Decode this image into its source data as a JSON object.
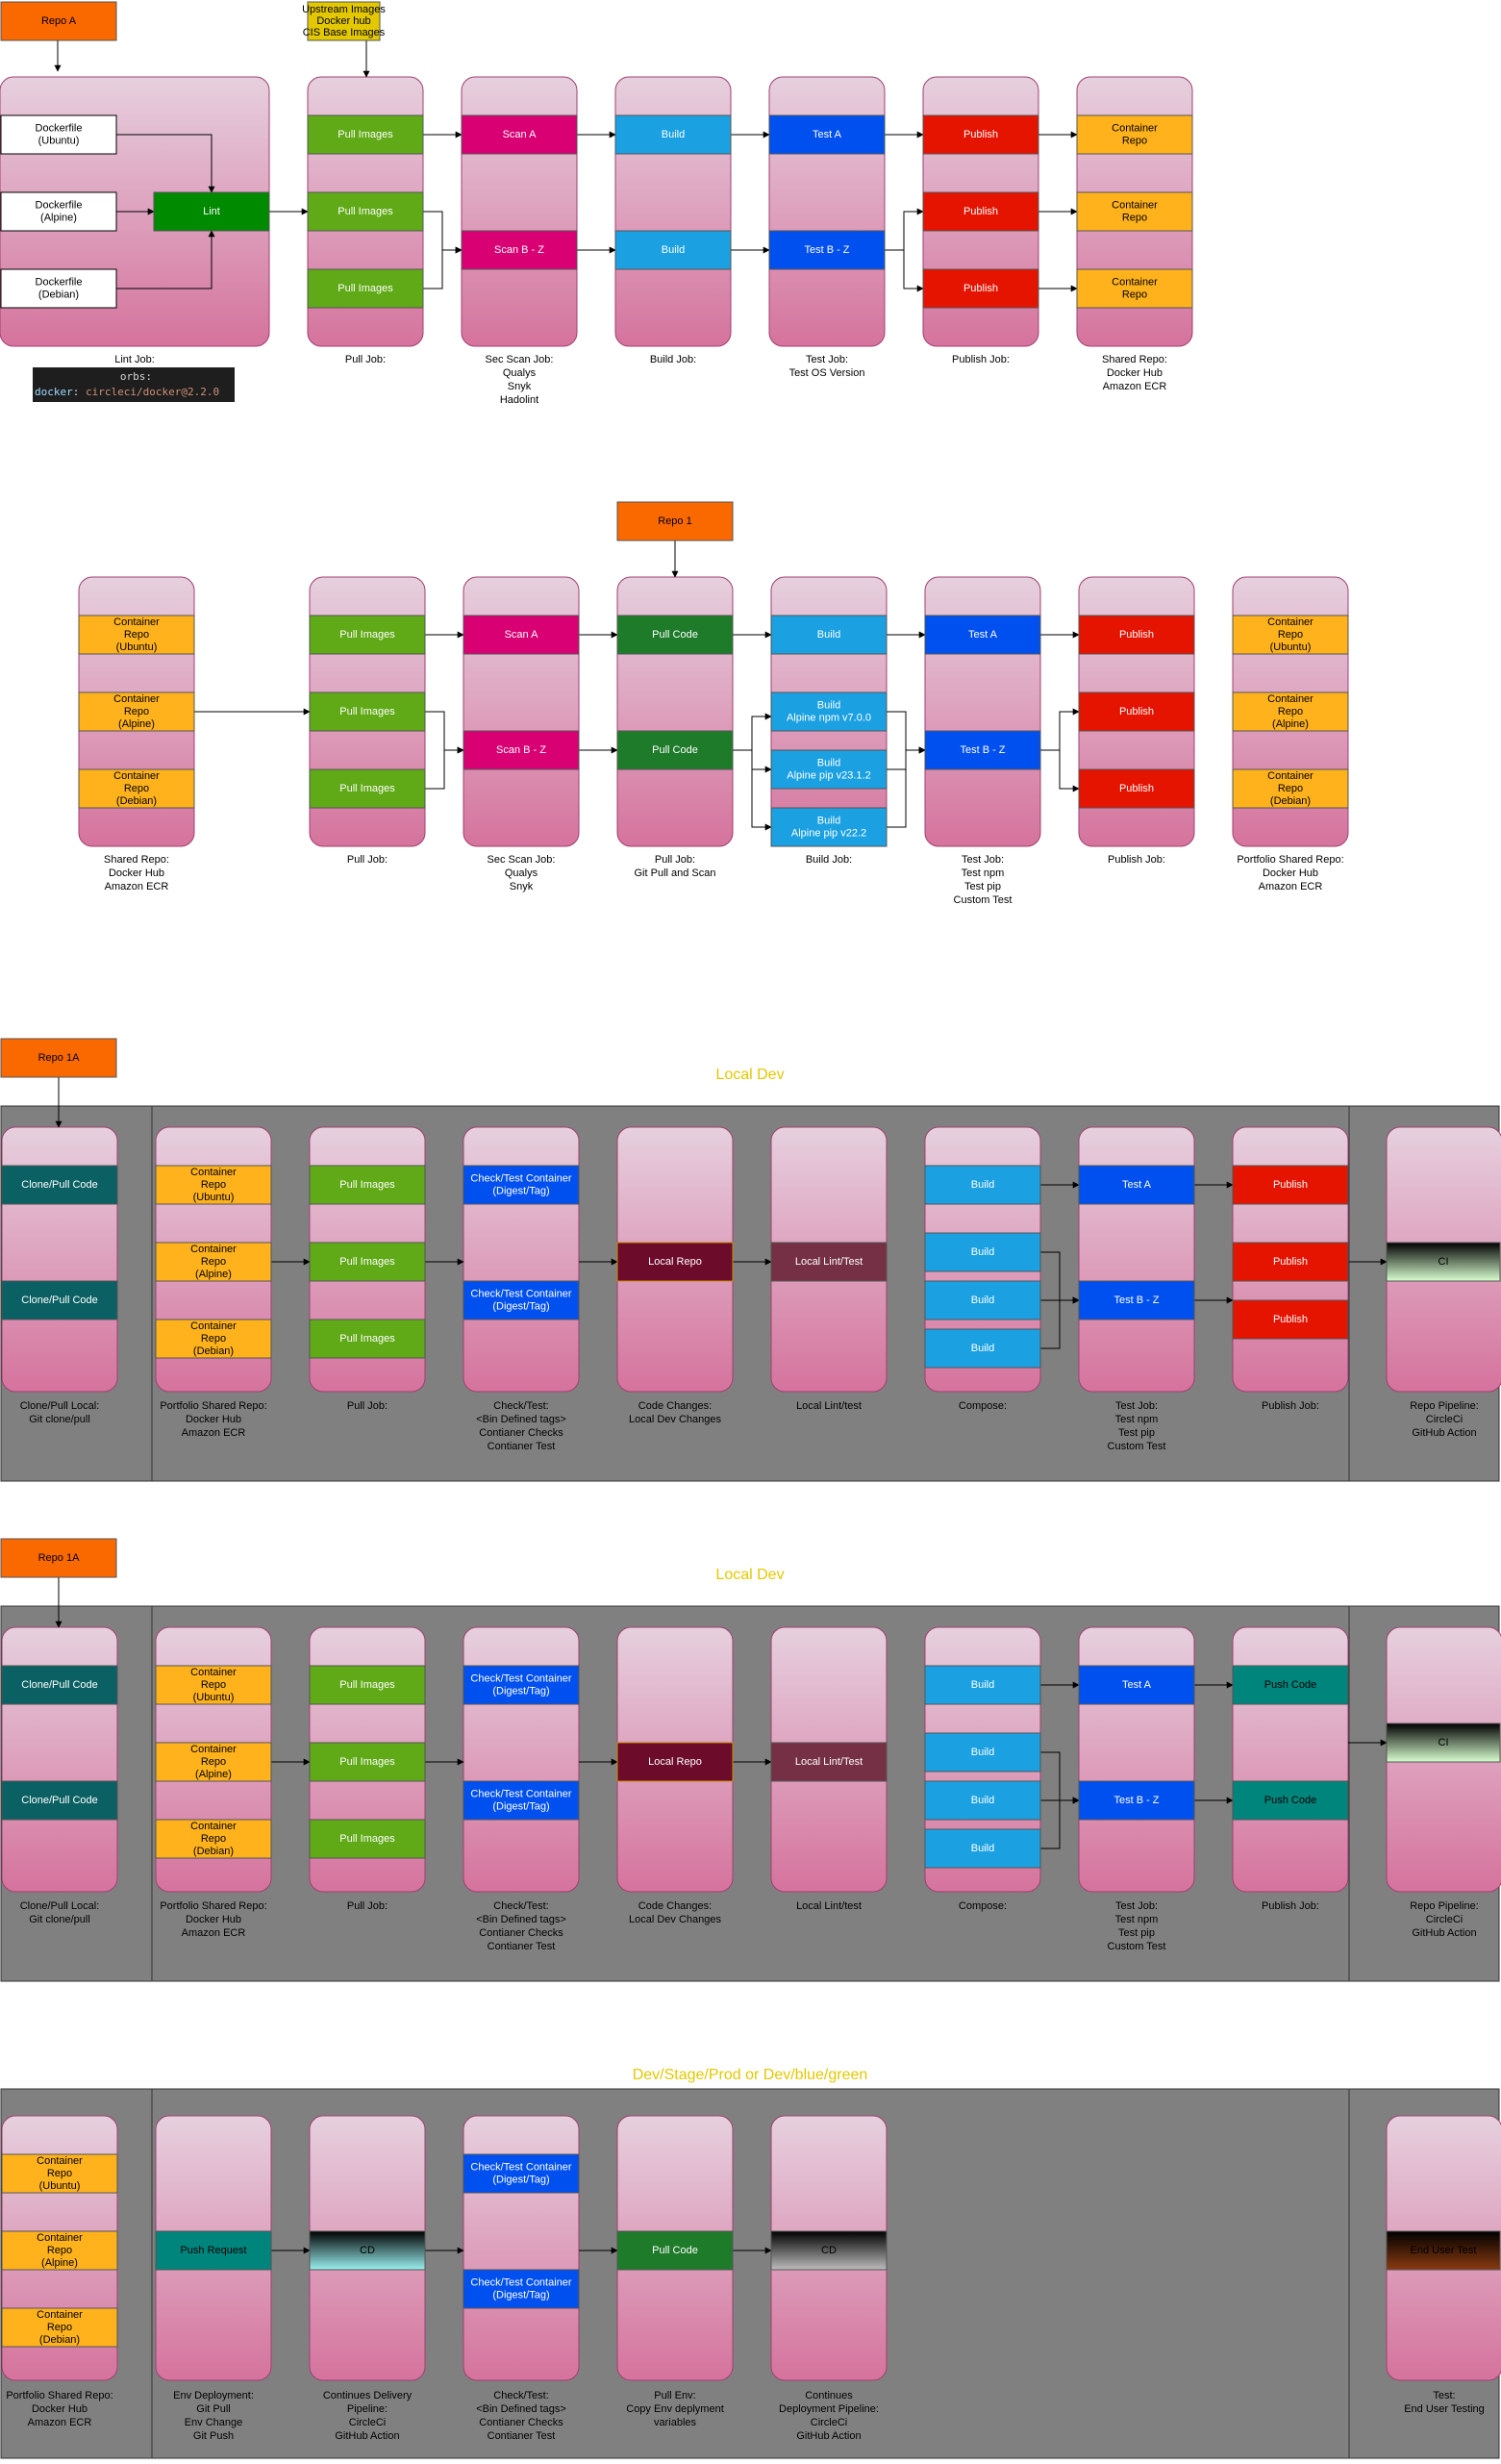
{
  "colors": {
    "orange": "#fa6800",
    "yellow": "#e3c800",
    "green": "#60a917",
    "magenta": "#d80073",
    "blue": "#1ba1e2",
    "cobalt": "#0050ef",
    "red": "#e51400",
    "amber": "#ffb21c",
    "darkgreen": "#1e7b2a",
    "teal": "#00857c",
    "darkteal": "#0b6063",
    "wine": "#6d0b2b",
    "plum": "#763045",
    "panel": "#808080"
  },
  "diagram1": {
    "repo": "Repo A",
    "upstream": [
      "Upstream Images",
      "Docker hub",
      "CIS Base Images"
    ],
    "dockerfiles": [
      [
        "Dockerfile",
        "(Ubuntu)"
      ],
      [
        "Dockerfile",
        "(Alpine)"
      ],
      [
        "Dockerfile",
        "(Debian)"
      ]
    ],
    "lint": "Lint",
    "lint_caption": "Lint Job:",
    "code_line1": "orbs:",
    "code_key": "docker",
    "code_val": "circleci/docker@2.2.0",
    "pull": "Pull Images",
    "pull_caption": [
      "Pull Job:"
    ],
    "scan_a": "Scan A",
    "scan_bz": "Scan B - Z",
    "scan_caption": [
      "Sec Scan Job:",
      "Qualys",
      "Snyk",
      "Hadolint"
    ],
    "build": "Build",
    "build_caption": [
      "Build Job:"
    ],
    "test_a": "Test A",
    "test_bz": "Test B - Z",
    "test_caption": [
      "Test Job:",
      "Test OS Version"
    ],
    "publish": "Publish",
    "publish_caption": [
      "Publish Job:"
    ],
    "container_repo": [
      "Container",
      "Repo"
    ],
    "shared_caption": [
      "Shared Repo:",
      "Docker Hub",
      "Amazon ECR"
    ]
  },
  "diagram2": {
    "repo": "Repo 1",
    "containers": [
      [
        "Container",
        "Repo",
        "(Ubuntu)"
      ],
      [
        "Container",
        "Repo",
        "(Alpine)"
      ],
      [
        "Container",
        "Repo",
        "(Debian)"
      ]
    ],
    "shared_caption": [
      "Shared Repo:",
      "Docker Hub",
      "Amazon ECR"
    ],
    "pull": "Pull Images",
    "pull_caption": [
      "Pull Job:"
    ],
    "scan_a": "Scan A",
    "scan_bz": "Scan B - Z",
    "scan_caption": [
      "Sec Scan Job:",
      "Qualys",
      "Snyk"
    ],
    "pull_code": "Pull Code",
    "pullcode_caption": [
      "Pull Job:",
      "Git Pull and Scan"
    ],
    "build": "Build",
    "builds": [
      [
        "Build",
        "Alpine npm v7.0.0"
      ],
      [
        "Build",
        "Alpine pip v23.1.2"
      ],
      [
        "Build",
        "Alpine pip v22.2"
      ]
    ],
    "build_caption": [
      "Build Job:"
    ],
    "test_a": "Test A",
    "test_bz": "Test B - Z",
    "test_caption": [
      "Test Job:",
      "Test npm",
      "Test pip",
      "Custom Test"
    ],
    "publish": "Publish",
    "publish_caption": [
      "Publish Job:"
    ],
    "portfolio_caption": [
      "Portfolio Shared Repo:",
      "Docker Hub",
      "Amazon ECR"
    ]
  },
  "diagram3": {
    "repo": "Repo 1A",
    "title": "Local Dev",
    "clone": "Clone/Pull Code",
    "clone_caption": [
      "Clone/Pull Local:",
      "Git clone/pull"
    ],
    "portfolio_caption": [
      "Portfolio Shared Repo:",
      "Docker Hub",
      "Amazon ECR"
    ],
    "pull": "Pull Images",
    "pull_caption": [
      "Pull Job:"
    ],
    "check": [
      "Check/Test Container",
      "(Digest/Tag)"
    ],
    "check_caption": [
      "Check/Test:",
      "<Bin Defined tags>",
      "Contianer Checks",
      "Contianer Test"
    ],
    "local_repo": "Local Repo",
    "code_caption": [
      "Code Changes:",
      "Local Dev Changes"
    ],
    "local_lint": "Local Lint/Test",
    "lint_caption": [
      "Local Lint/test"
    ],
    "build": "Build",
    "compose_caption": [
      "Compose:"
    ],
    "test_a": "Test A",
    "test_bz": "Test B - Z",
    "test_caption": [
      "Test Job:",
      "Test npm",
      "Test pip",
      "Custom Test"
    ],
    "publish": "Publish",
    "publish_caption": [
      "Publish Job:"
    ],
    "ci": "CI",
    "pipeline_caption": [
      "Repo Pipeline:",
      "CircleCi",
      "GitHub Action"
    ]
  },
  "diagram4": {
    "repo": "Repo 1A",
    "title": "Local Dev",
    "push_code": "Push Code"
  },
  "diagram5": {
    "title": "Dev/Stage/Prod or Dev/blue/green",
    "push_request": "Push Request",
    "env_caption": [
      "Env Deployment:",
      "Git Pull",
      "Env Change",
      "Git Push"
    ],
    "cd": "CD",
    "cd_caption": [
      "Continues Delivery",
      "Pipeline:",
      "CircleCi",
      "GitHub Action"
    ],
    "pull_code": "Pull Code",
    "pullenv_caption": [
      "Pull Env:",
      "Copy Env deplyment",
      "variables"
    ],
    "deploy_caption": [
      "Continues",
      "Deployment Pipeline:",
      "CircleCi",
      "GitHub Action"
    ],
    "end_user": "End User Test",
    "endtest_caption": [
      "Test:",
      "End User Testing"
    ]
  }
}
